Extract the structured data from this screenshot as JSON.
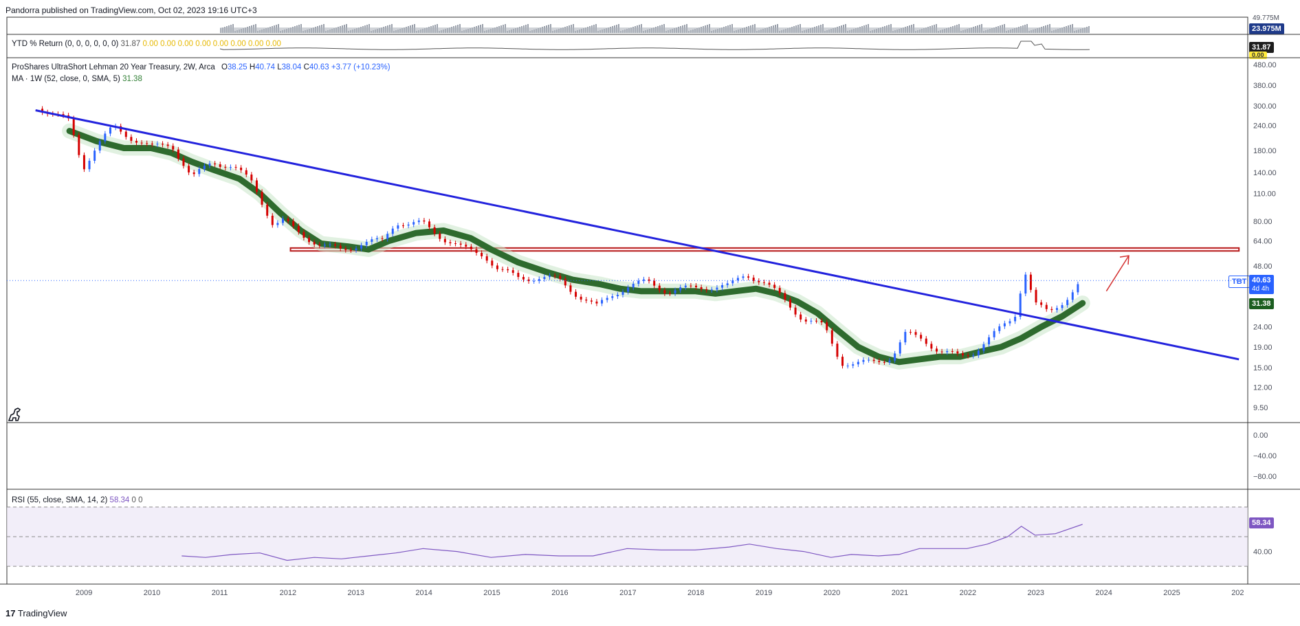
{
  "header": {
    "publish_line": "Pandorra published on TradingView.com, Oct 02, 2023 19:16 UTC+3"
  },
  "footer": {
    "brand": "TradingView"
  },
  "colors": {
    "candle_up": "#2962ff",
    "candle_down": "#d50000",
    "ma": "#2e6b2e",
    "trendline": "#2222dd",
    "zone": "#b71c1c",
    "rsi": "#7e57c2"
  },
  "volume_pane": {
    "labels": [
      "49.775M",
      "23.975M"
    ]
  },
  "ytd_pane": {
    "title": "YTD % Return (0, 0, 0, 0, 0, 0)",
    "value": "31.87",
    "zeros": "0.00 0.00 0.00 0.00 0.00 0.00 0.00 0.00",
    "last_badge": "31.87",
    "zero_badge": "0.00"
  },
  "main_pane": {
    "title_name": "ProShares UltraShort Lehman 20 Year Treasury, 2W, Arca",
    "ohlc": {
      "o_label": "O",
      "o": "38.25",
      "h_label": "H",
      "h": "40.74",
      "l_label": "L",
      "l": "38.04",
      "c_label": "C",
      "c": "40.63",
      "chg": "+3.77 (+10.23%)"
    },
    "ma_label": "MA · 1W (52, close, 0, SMA, 5)",
    "ma_value": "31.38",
    "symbol_badge": "TBT",
    "price_badge": "40.63",
    "countdown_badge": "4d 4h",
    "ma_badge": "31.38",
    "price_axis": [
      "480.00",
      "380.00",
      "300.00",
      "240.00",
      "180.00",
      "140.00",
      "110.00",
      "80.00",
      "64.00",
      "48.00",
      "24.00",
      "19.00",
      "15.00",
      "12.00",
      "9.50"
    ]
  },
  "empty_pane": {
    "axis": [
      "0.00",
      "−40.00",
      "−80.00"
    ]
  },
  "rsi_pane": {
    "title": "RSI (55, close, SMA, 14, 2)",
    "value": "58.34",
    "extra": "0  0",
    "axis": [
      "40.00"
    ],
    "badge": "58.34"
  },
  "time_axis": [
    "2009",
    "2010",
    "2011",
    "2012",
    "2013",
    "2014",
    "2015",
    "2016",
    "2017",
    "2018",
    "2019",
    "2020",
    "2021",
    "2022",
    "2023",
    "2024",
    "2025",
    "202"
  ],
  "chart_data": {
    "type": "line",
    "title": "ProShares UltraShort Lehman 20 Year Treasury, 2W, Arca",
    "ylabel": "",
    "xlabel": "",
    "y_scale": "log",
    "ylim": [
      8,
      520
    ],
    "xlim": [
      2008.0,
      2026.0
    ],
    "series": [
      {
        "name": "",
        "x": [
          2008.4,
          2008.8,
          2009.0,
          2009.2,
          2009.45,
          2009.7,
          2010.0,
          2010.3,
          2010.6,
          2010.9,
          2011.2,
          2011.5,
          2011.8,
          2011.95,
          2012.2,
          2012.5,
          2012.8,
          2013.1,
          2013.4,
          2013.6,
          2013.8,
          2014.0,
          2014.3,
          2014.6,
          2014.9,
          2015.1,
          2015.4,
          2015.7,
          2016.0,
          2016.3,
          2016.55,
          2016.8,
          2017.0,
          2017.3,
          2017.6,
          2017.9,
          2018.2,
          2018.5,
          2018.75,
          2019.0,
          2019.3,
          2019.6,
          2019.9,
          2020.15,
          2020.35,
          2020.6,
          2020.9,
          2021.1,
          2021.35,
          2021.6,
          2021.9,
          2022.1,
          2022.4,
          2022.7,
          2022.85,
          2023.0,
          2023.2,
          2023.45,
          2023.7
        ],
        "y": [
          290,
          250,
          148,
          190,
          235,
          210,
          185,
          195,
          130,
          160,
          148,
          125,
          76,
          80,
          70,
          60,
          58,
          62,
          64,
          80,
          77,
          78,
          66,
          58,
          55,
          46,
          42,
          42,
          41,
          34,
          30,
          35,
          38,
          40,
          36,
          37,
          38,
          38,
          44,
          40,
          33,
          26,
          24,
          16,
          15.5,
          16,
          17,
          22,
          21,
          18,
          17,
          18,
          22,
          27,
          46,
          31,
          28,
          33,
          40.63
        ]
      },
      {
        "name": "MA · 1W (52, close, 0, SMA, 5)",
        "x": [
          2008.8,
          2009.2,
          2009.6,
          2010.0,
          2010.3,
          2010.6,
          2010.9,
          2011.3,
          2011.6,
          2011.9,
          2012.2,
          2012.5,
          2012.9,
          2013.2,
          2013.5,
          2013.9,
          2014.3,
          2014.7,
          2015.0,
          2015.4,
          2015.8,
          2016.2,
          2016.6,
          2016.9,
          2017.2,
          2017.6,
          2018.0,
          2018.3,
          2018.6,
          2018.9,
          2019.2,
          2019.5,
          2019.8,
          2020.1,
          2020.4,
          2020.7,
          2021.0,
          2021.3,
          2021.6,
          2021.9,
          2022.2,
          2022.5,
          2022.8,
          2023.1,
          2023.4,
          2023.7
        ],
        "y": [
          225,
          200,
          185,
          185,
          175,
          158,
          145,
          130,
          110,
          88,
          72,
          62,
          60,
          58,
          64,
          70,
          72,
          66,
          58,
          50,
          45,
          41,
          39,
          37,
          36,
          36,
          36,
          35,
          36,
          37,
          35,
          32,
          28,
          23,
          19,
          17,
          16,
          16.5,
          17,
          17,
          18,
          19,
          21,
          24,
          27,
          31.38
        ]
      },
      {
        "name": "RSI (55, close, SMA, 14, 2)",
        "x": [
          2010.45,
          2010.8,
          2011.2,
          2011.6,
          2012.0,
          2012.4,
          2012.8,
          2013.2,
          2013.6,
          2014.0,
          2014.5,
          2015.0,
          2015.5,
          2016.0,
          2016.5,
          2017.0,
          2017.5,
          2018.0,
          2018.5,
          2018.8,
          2019.2,
          2019.6,
          2020.0,
          2020.3,
          2020.7,
          2021.0,
          2021.3,
          2021.7,
          2022.0,
          2022.3,
          2022.6,
          2022.8,
          2023.0,
          2023.3,
          2023.7
        ],
        "y": [
          37,
          36,
          38,
          39,
          34,
          36,
          35,
          37,
          39,
          42,
          40,
          36,
          38,
          37,
          37,
          42,
          41,
          41,
          43,
          45,
          42,
          40,
          36,
          38,
          37,
          38,
          42,
          42,
          42,
          45,
          50,
          57,
          51,
          52,
          58.34
        ]
      }
    ],
    "trendline": {
      "x": [
        2008.3,
        2026.0
      ],
      "y": [
        285,
        16.5
      ]
    },
    "resistance_zone": {
      "x": [
        2012.05,
        2026.0
      ],
      "y": [
        57,
        59
      ]
    },
    "arrow": {
      "x": [
        2024.05,
        2024.38
      ],
      "y": [
        36,
        54
      ]
    },
    "rsi_levels": [
      70,
      50,
      30
    ],
    "price_labels": [
      "480.00",
      "380.00",
      "300.00",
      "240.00",
      "180.00",
      "140.00",
      "110.00",
      "80.00",
      "64.00",
      "48.00",
      "24.00",
      "19.00",
      "15.00",
      "12.00",
      "9.50"
    ],
    "grid": false,
    "legend": "top-left"
  }
}
